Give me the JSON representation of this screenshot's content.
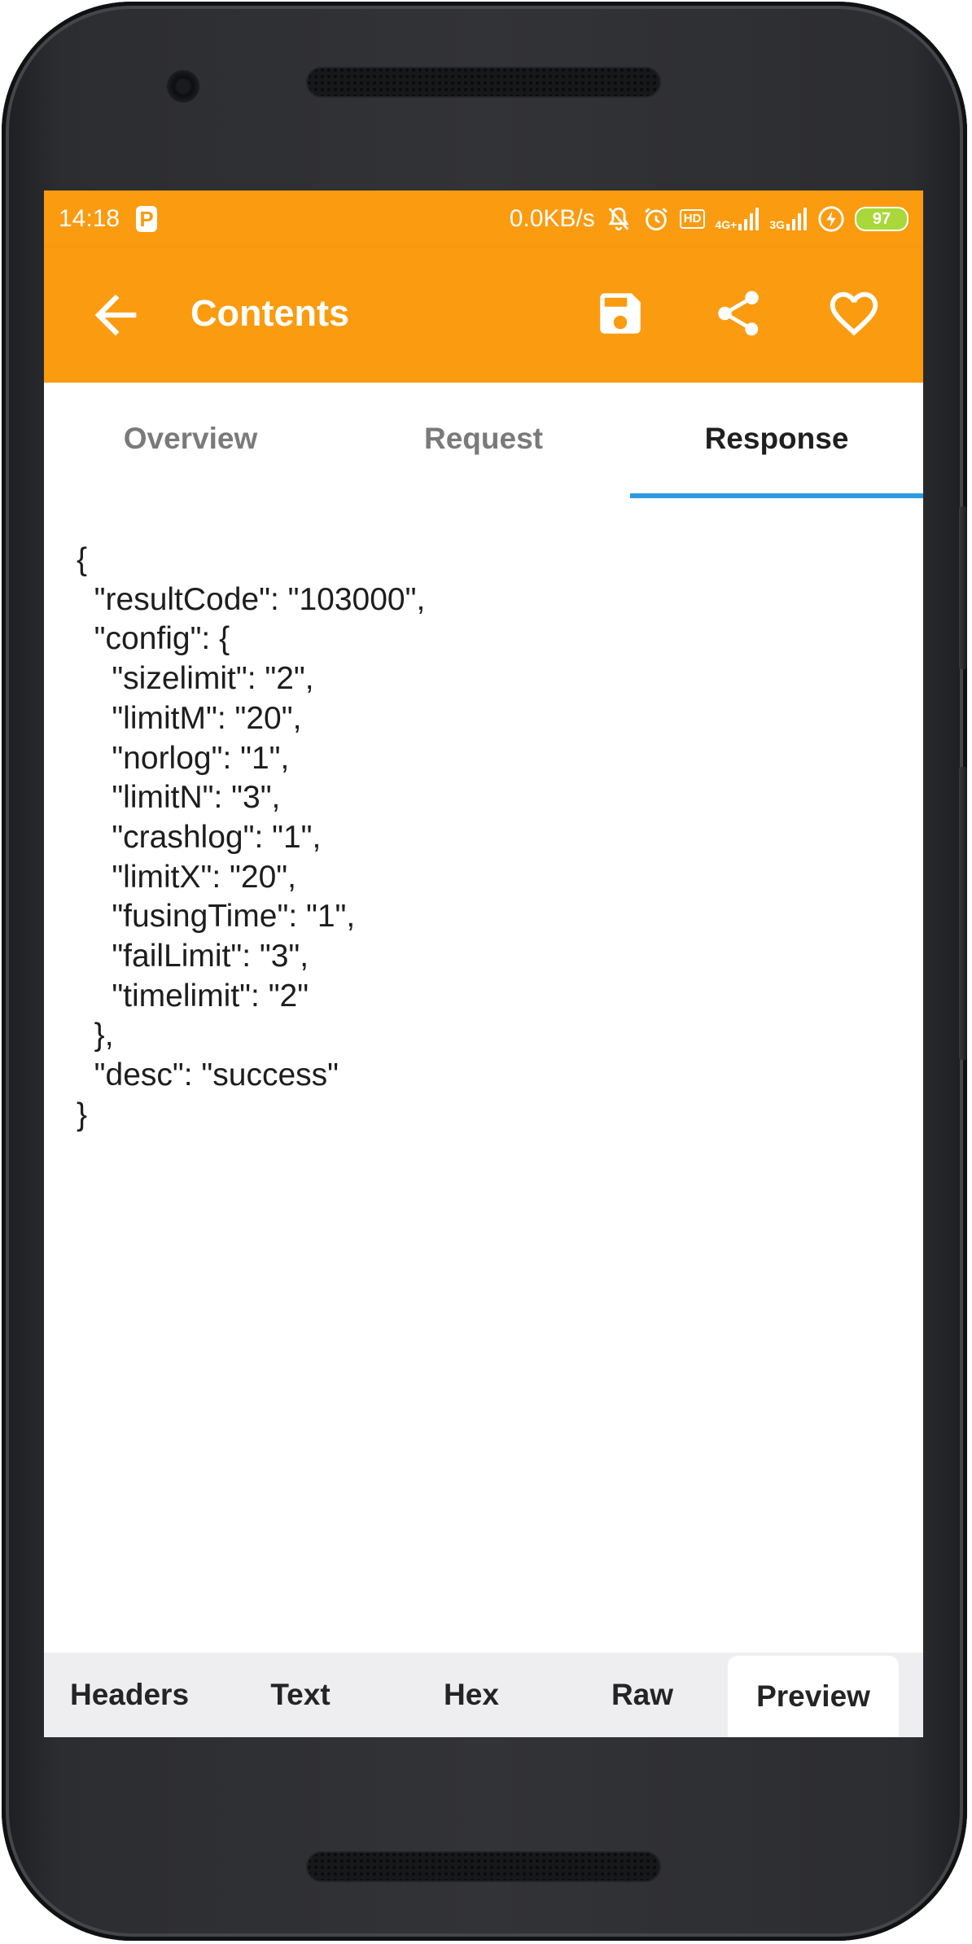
{
  "status_bar": {
    "time": "14:18",
    "app_badge": "P",
    "net_speed": "0.0KB/s",
    "signal_1": "4G+",
    "signal_2": "3G",
    "hd_label": "HD",
    "battery": "97"
  },
  "app_bar": {
    "title": "Contents",
    "background": "#fb9b10",
    "icons": [
      "arrow-back-icon",
      "save-icon",
      "share-icon",
      "heart-icon"
    ]
  },
  "tabs": {
    "items": [
      {
        "label": "Overview",
        "active": false
      },
      {
        "label": "Request",
        "active": false
      },
      {
        "label": "Response",
        "active": true
      }
    ],
    "indicator_color": "#2b9be0"
  },
  "response_body": "{\n  \"resultCode\": \"103000\",\n  \"config\": {\n    \"sizelimit\": \"2\",\n    \"limitM\": \"20\",\n    \"norlog\": \"1\",\n    \"limitN\": \"3\",\n    \"crashlog\": \"1\",\n    \"limitX\": \"20\",\n    \"fusingTime\": \"1\",\n    \"failLimit\": \"3\",\n    \"timelimit\": \"2\"\n  },\n  \"desc\": \"success\"\n}",
  "bottom_tabs": {
    "items": [
      {
        "label": "Headers",
        "active": false
      },
      {
        "label": "Text",
        "active": false
      },
      {
        "label": "Hex",
        "active": false
      },
      {
        "label": "Raw",
        "active": false
      },
      {
        "label": "Preview",
        "active": true
      }
    ]
  }
}
